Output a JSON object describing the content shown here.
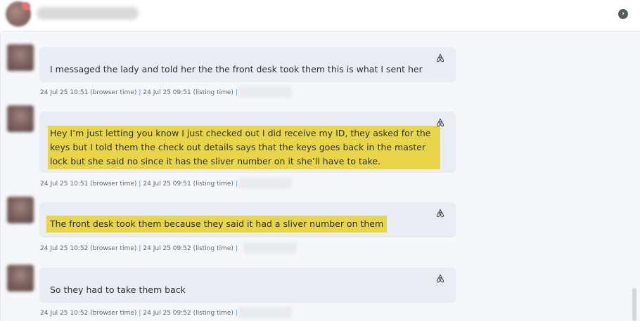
{
  "header": {
    "nav_icon": "chevron-right-circle-icon"
  },
  "messages": [
    {
      "text": "I messaged the lady and told her the the front desk took them this is what I sent her",
      "browser_time": "24 Jul 25 10:51 (browser time)",
      "listing_time": "24 Jul 25 09:51 (listing time)",
      "highlighted": false
    },
    {
      "text": "Hey I’m just letting you know I just checked out I did receive my ID, they asked for the keys but I told them the check out details says that the keys goes back in the master lock but she said no since it has the sliver number on it she’ll have to take.",
      "browser_time": "24 Jul 25 10:51 (browser time)",
      "listing_time": "24 Jul 25 09:51 (listing time)",
      "highlighted": true
    },
    {
      "text": "The front desk took them because they said it had a sliver number on them",
      "browser_time": "24 Jul 25 10:52 (browser time)",
      "listing_time": "24 Jul 25 09:52 (listing time)",
      "highlighted": true
    },
    {
      "text": "So they had to take them back",
      "browser_time": "24 Jul 25 10:52 (browser time)",
      "listing_time": "24 Jul 25 09:52 (listing time)",
      "highlighted": false
    }
  ],
  "meta_separator": "|",
  "colors": {
    "highlight": "#e8d54a",
    "bubble": "#eaecf3",
    "thread_bg": "#f6f7fa",
    "separator": "#4a90e2"
  },
  "icons": {
    "channel": "airbnb-icon"
  }
}
